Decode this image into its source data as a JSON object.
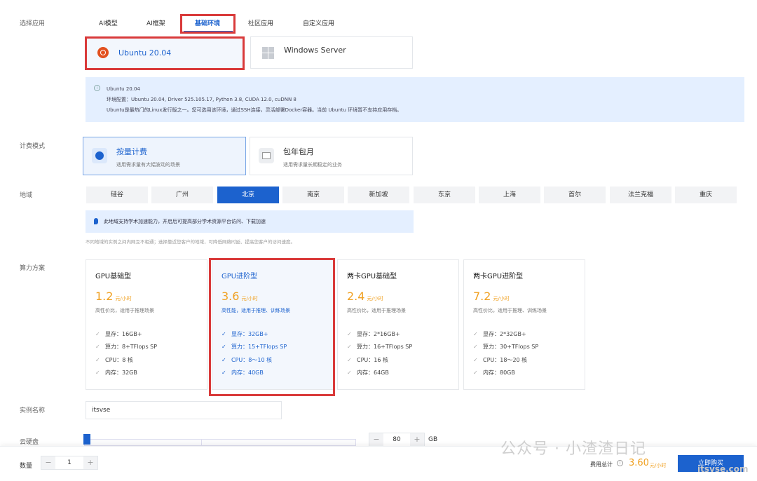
{
  "labels": {
    "select_app": "选择应用",
    "billing_mode": "计费模式",
    "region": "地域",
    "compute": "算力方案",
    "instance_name": "实例名称",
    "cloud_disk": "云硬盘",
    "quantity": "数量"
  },
  "tabs": [
    "AI模型",
    "AI框架",
    "基础环境",
    "社区应用",
    "自定义应用"
  ],
  "os": [
    {
      "name": "Ubuntu 20.04",
      "icon": "ubuntu-icon"
    },
    {
      "name": "Windows Server",
      "icon": "windows-icon"
    }
  ],
  "info": {
    "line1": "Ubuntu 20.04",
    "line2": "环境配置：Ubuntu 20.04, Driver 525.105.17, Python 3.8, CUDA 12.0, cuDNN 8",
    "line3": "Ubuntu是最热门的Linux发行版之一。您可选用该环境，通过SSH连接，灵活部署Docker容器。当前 Ubuntu 环境暂不支持应用存档。"
  },
  "billing": [
    {
      "title": "按量计费",
      "desc": "适用需求量有大幅波动的场景"
    },
    {
      "title": "包年包月",
      "desc": "适用需求量长期稳定的业务"
    }
  ],
  "regions": [
    "硅谷",
    "广州",
    "北京",
    "南京",
    "新加坡",
    "东京",
    "上海",
    "首尔",
    "法兰克福",
    "重庆"
  ],
  "accel_note": "此地域支持学术加速能力，开启后可提高部分学术资源平台访问、下载加速",
  "region_note": "不同地域的实例之间内网互不相通；选择靠近您客户的地域，可降低网络时延、提高您客户的访问速度。",
  "plans": [
    {
      "name": "GPU基础型",
      "price": "1.2",
      "unit": "元/小时",
      "desc": "高性价比，适用于推理场景",
      "specs": [
        "显存：16GB+",
        "算力：8+TFlops SP",
        "CPU：8 核",
        "内存：32GB"
      ]
    },
    {
      "name": "GPU进阶型",
      "price": "3.6",
      "unit": "元/小时",
      "desc": "高性能，适用于推理、训练场景",
      "specs": [
        "显存：32GB+",
        "算力：15+TFlops SP",
        "CPU：8～10 核",
        "内存：40GB"
      ]
    },
    {
      "name": "两卡GPU基础型",
      "price": "2.4",
      "unit": "元/小时",
      "desc": "高性价比，适用于推理场景",
      "specs": [
        "显存：2*16GB+",
        "算力：16+TFlops SP",
        "CPU：16 核",
        "内存：64GB"
      ]
    },
    {
      "name": "两卡GPU进阶型",
      "price": "7.2",
      "unit": "元/小时",
      "desc": "高性价比，适用于推理、训练场景",
      "specs": [
        "显存：2*32GB+",
        "算力：30+TFlops SP",
        "CPU：18～20 核",
        "内存：80GB"
      ]
    }
  ],
  "instance_value": "itsvse",
  "disk": {
    "value": "80",
    "unit": "GB",
    "minus": "−",
    "plus": "+"
  },
  "quantity": {
    "value": "1",
    "minus": "−",
    "plus": "+"
  },
  "footer": {
    "total_label": "费用总计",
    "total_price": "3.60",
    "total_unit": "元/小时",
    "buy": "立即购买"
  },
  "watermark": {
    "text": "公众号 · 小渣渣日记",
    "site": "itsvse.com"
  },
  "colors": {
    "primary": "#1c62ce",
    "price": "#f0a020",
    "highlight_box": "#d93a3a"
  }
}
